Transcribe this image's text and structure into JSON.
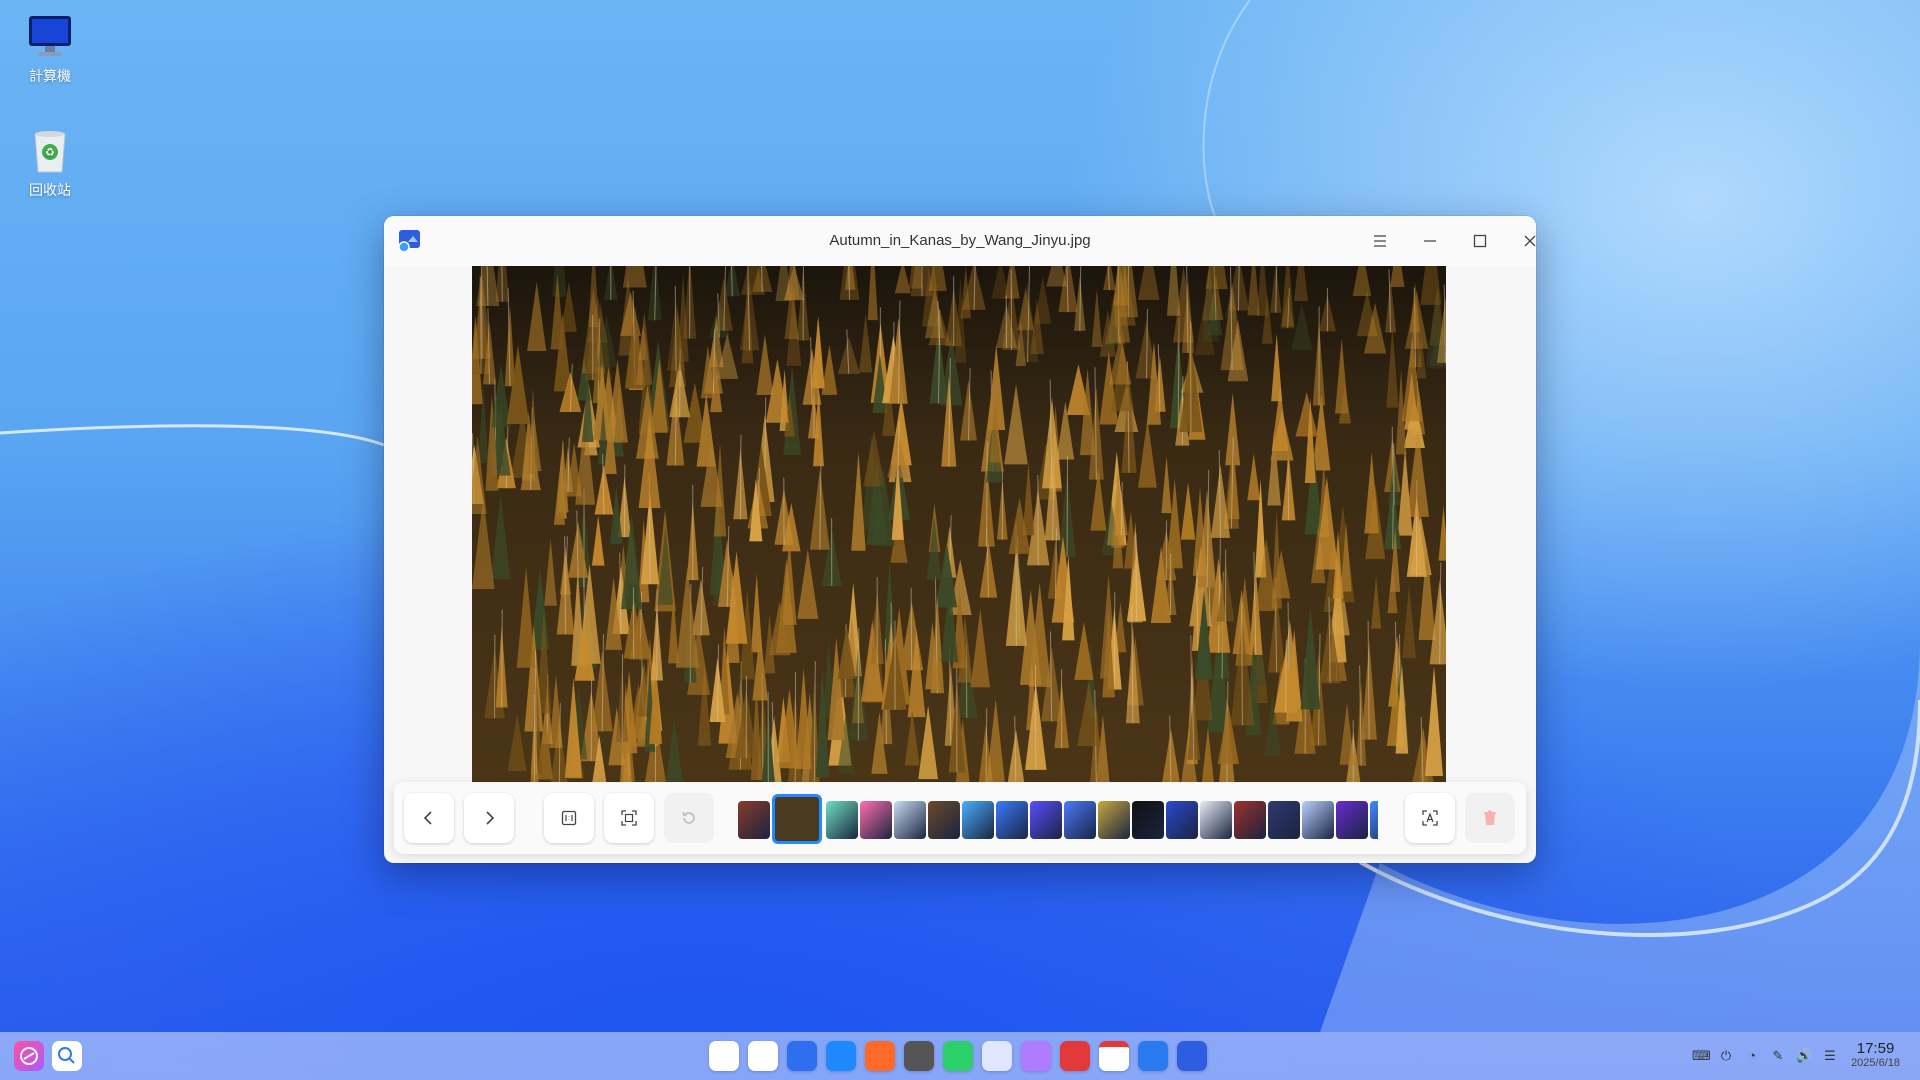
{
  "desktop": {
    "icons": [
      {
        "label": "計算機",
        "icon": "monitor-icon"
      },
      {
        "label": "回收站",
        "icon": "trash-bin-icon"
      }
    ]
  },
  "window": {
    "title": "Autumn_in_Kanas_by_Wang_Jinyu.jpg",
    "controls": [
      "menu-icon",
      "minimize-icon",
      "maximize-icon",
      "close-icon"
    ]
  },
  "toolbar": {
    "buttons": [
      "previous-icon",
      "next-icon",
      "original-size-icon",
      "fit-window-icon",
      "rotate-icon",
      "ocr-icon",
      "delete-icon"
    ],
    "thumbnail_count": 19,
    "active_thumbnail_index": 1
  },
  "taskbar": {
    "time": "17:59",
    "date": "2025/6/18"
  },
  "colors": {
    "accent": "#1e8bff",
    "window_bg": "#f7f7f7"
  }
}
